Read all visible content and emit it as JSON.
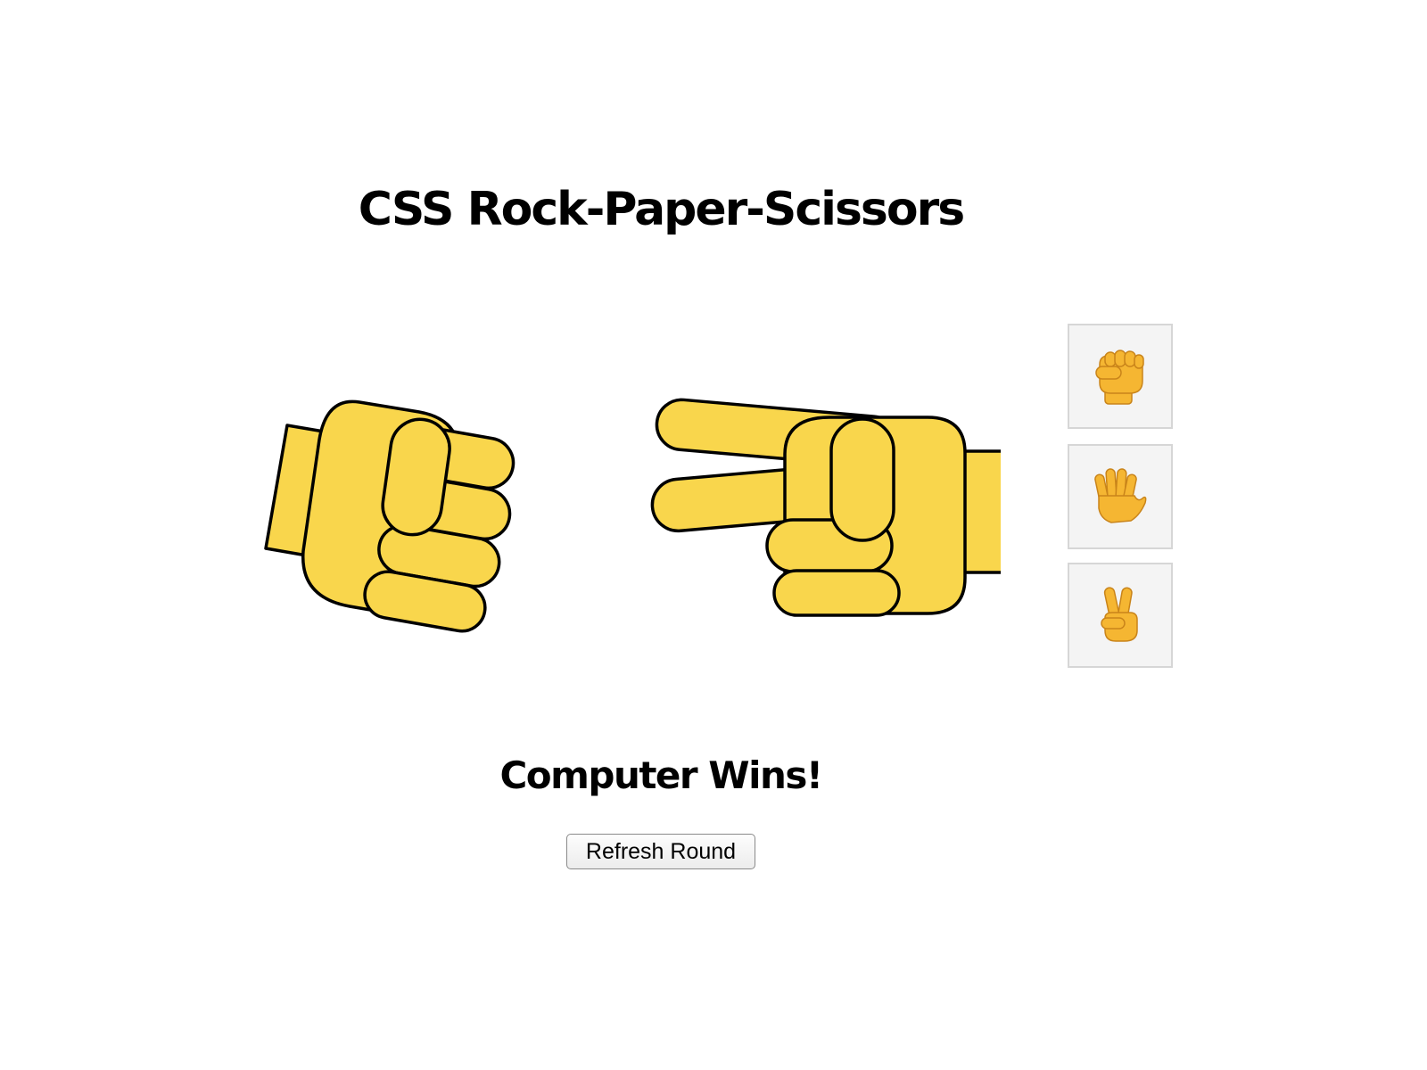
{
  "game": {
    "title": "CSS Rock-Paper-Scissors",
    "player_hand": "rock",
    "computer_hand": "scissors",
    "result": "Computer Wins!",
    "refresh_label": "Refresh Round"
  },
  "choices": [
    {
      "name": "rock",
      "icon": "raised-fist-icon"
    },
    {
      "name": "paper",
      "icon": "raised-hand-icon"
    },
    {
      "name": "scissors",
      "icon": "victory-hand-icon"
    }
  ],
  "colors": {
    "skin": "#F9D64C",
    "outline": "#000000",
    "choice_bg": "#F4F4F4",
    "emoji_skin": "#F5B632"
  }
}
